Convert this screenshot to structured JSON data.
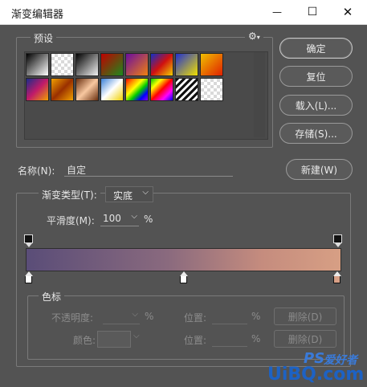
{
  "window": {
    "title": "渐变编辑器",
    "minimize": "—",
    "maximize": "☐",
    "close": "✕"
  },
  "presets": {
    "label": "预设",
    "gear": "⚙",
    "swatches": [
      "linear-gradient(135deg,#000,#fff)",
      "repeating-conic-gradient(#d9d9d9 0 25%,#fff 0 50%) 0 0/8px 8px",
      "linear-gradient(135deg,#000,#f2f2f2)",
      "linear-gradient(135deg,#c00000,#1c8a1c)",
      "linear-gradient(135deg,#6a0da0,#f08010)",
      "linear-gradient(135deg,#1030c8,#d01010,#f0d000)",
      "linear-gradient(135deg,#2030d0,#f0e000)",
      "linear-gradient(135deg,#f0c000,#e02000)",
      "linear-gradient(135deg,#1a2d8a,#c01a6a,#f0a000)",
      "linear-gradient(135deg,#f0a000,#9a3000,#f0a000)",
      "linear-gradient(135deg,#6a3010,#f8c8a0,#6a3010)",
      "linear-gradient(135deg,#3a80d8,#fff,#f0d000)",
      "linear-gradient(135deg,#f00,#f80,#ff0,#0c0,#00f,#80f)",
      "linear-gradient(135deg,#0c0,#ff0,#f00,#f0f,#00f)",
      "repeating-linear-gradient(135deg,#111 0 3px,#fff 3px 6px)",
      "repeating-conic-gradient(#d9d9d9 0 25%,#fff 0 50%) 0 0/8px 8px"
    ]
  },
  "buttons": {
    "ok": "确定",
    "reset": "复位",
    "load": "载入(L)...",
    "save": "存储(S)...",
    "new": "新建(W)"
  },
  "name": {
    "label": "名称(N):",
    "value": "自定"
  },
  "gradient": {
    "type_label": "渐变类型(T):",
    "type_value": "实底",
    "smooth_label": "平滑度(M):",
    "smooth_value": "100",
    "smooth_unit": "%"
  },
  "stops": {
    "label": "色标",
    "opacity_label": "不透明度:",
    "color_label": "颜色:",
    "percent": "%",
    "location_label": "位置:",
    "delete": "删除(D)"
  },
  "watermark": {
    "ps": "PS",
    "site": "UiBQ.com",
    "cn": "爱好者"
  },
  "colors": {
    "gradient_start": "#5a4d78",
    "gradient_end": "#d79f84",
    "bottom_stop_left": "#ffffff",
    "bottom_stop_mid": "#ffffff",
    "bottom_stop_right": "#d8a086"
  }
}
